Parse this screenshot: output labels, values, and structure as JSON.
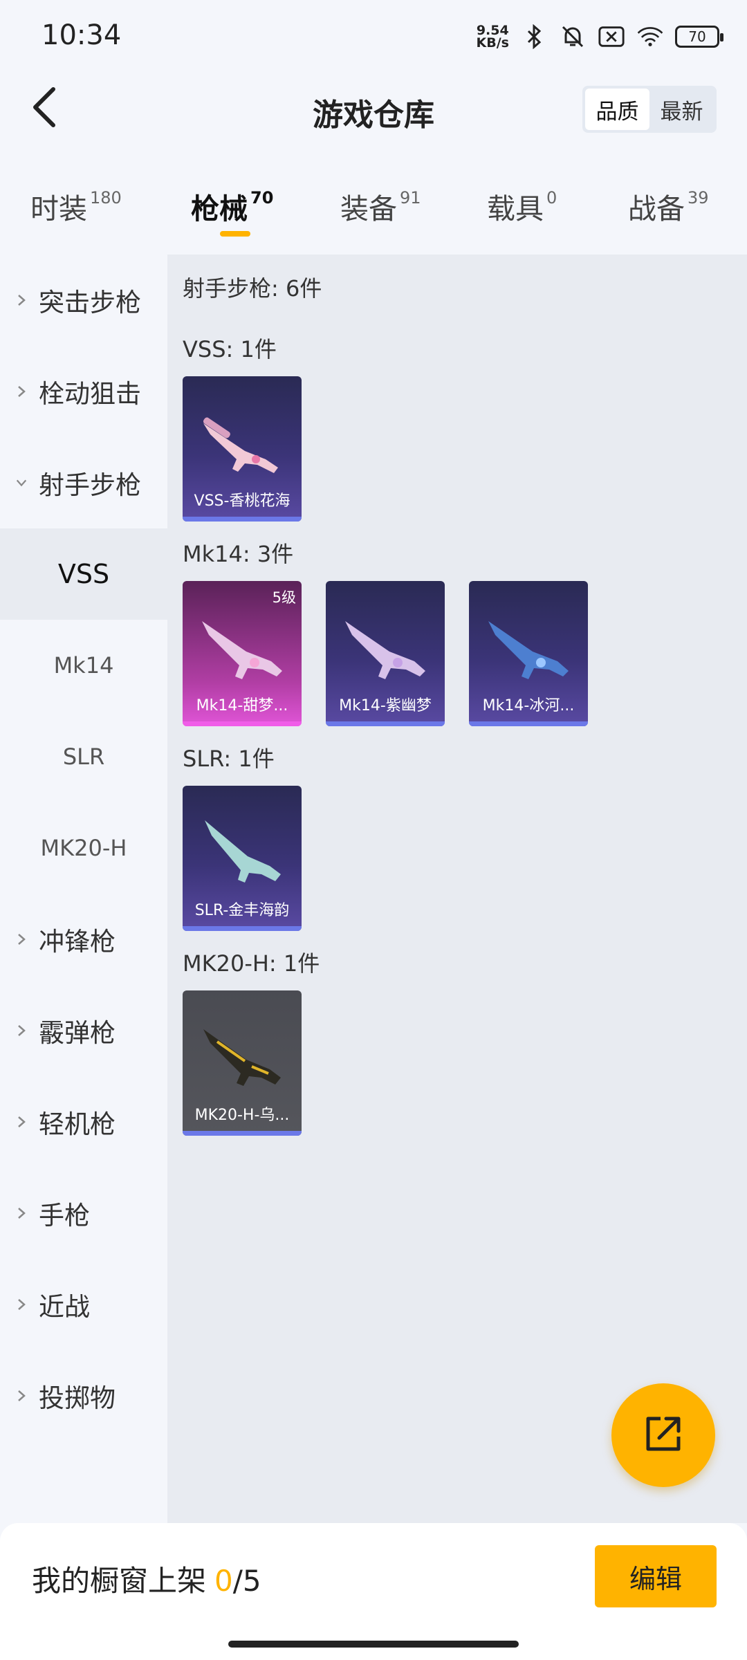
{
  "status_bar": {
    "time": "10:34",
    "net_speed_value": "9.54",
    "net_speed_unit": "KB/s",
    "battery": "70",
    "icons": [
      "bluetooth-icon",
      "mute-bell-icon",
      "sim-off-icon",
      "wifi-icon",
      "battery-icon"
    ]
  },
  "header": {
    "title": "游戏仓库",
    "sort_options": [
      "品质",
      "最新"
    ],
    "active_sort": "品质"
  },
  "tabs": [
    {
      "label": "时装",
      "count": "180"
    },
    {
      "label": "枪械",
      "count": "70",
      "active": true
    },
    {
      "label": "装备",
      "count": "91"
    },
    {
      "label": "载具",
      "count": "0"
    },
    {
      "label": "战备",
      "count": "39"
    }
  ],
  "sidebar": {
    "categories": [
      "突击步枪",
      "栓动狙击",
      "射手步枪",
      "冲锋枪",
      "霰弹枪",
      "轻机枪",
      "手枪",
      "近战",
      "投掷物"
    ],
    "expanded": "射手步枪",
    "subitems": [
      "VSS",
      "Mk14",
      "SLR",
      "MK20-H"
    ],
    "active_sub": "VSS"
  },
  "content": {
    "total_title": "射手步枪: 6件",
    "groups": [
      {
        "title": "VSS: 1件",
        "items": [
          {
            "name": "VSS-香桃花海",
            "tier": "purple"
          }
        ]
      },
      {
        "title": "Mk14: 3件",
        "items": [
          {
            "name": "Mk14-甜梦...",
            "tier": "pink",
            "level": "5级"
          },
          {
            "name": "Mk14-紫幽梦",
            "tier": "purple"
          },
          {
            "name": "Mk14-冰河...",
            "tier": "purple"
          }
        ]
      },
      {
        "title": "SLR: 1件",
        "items": [
          {
            "name": "SLR-金丰海韵",
            "tier": "purple"
          }
        ]
      },
      {
        "title": "MK20-H: 1件",
        "items": [
          {
            "name": "MK20-H-乌...",
            "tier": "gray"
          }
        ]
      }
    ]
  },
  "bottom": {
    "shelf_label": "我的橱窗上架",
    "shelf_count": "0",
    "shelf_total": "/5",
    "edit_label": "编辑"
  },
  "colors": {
    "accent": "#ffb300",
    "card_purple": "#3b3478",
    "card_pink": "#b13ea4",
    "card_gray": "#55565c"
  }
}
